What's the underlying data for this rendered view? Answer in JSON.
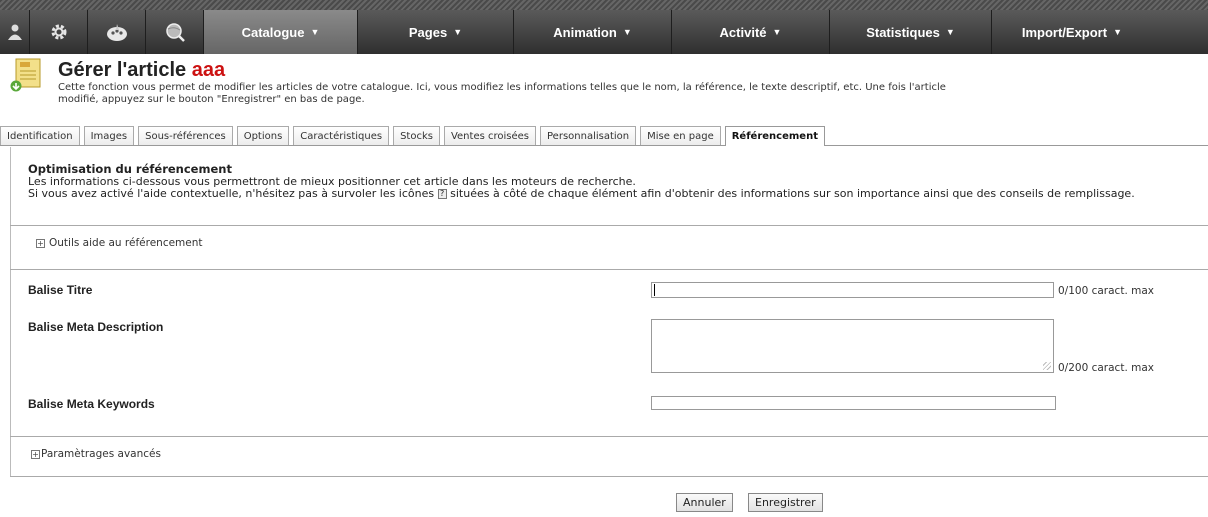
{
  "nav": {
    "icons": [
      "user-icon",
      "gear-icon",
      "palette-icon",
      "globe-icon"
    ],
    "items": [
      {
        "label": "Catalogue",
        "active": true
      },
      {
        "label": "Pages",
        "active": false
      },
      {
        "label": "Animation",
        "active": false
      },
      {
        "label": "Activité",
        "active": false
      },
      {
        "label": "Statistiques",
        "active": false
      },
      {
        "label": "Import/Export",
        "active": false
      }
    ],
    "caret": "▼"
  },
  "header": {
    "title": "Gérer l'article",
    "article_name": "aaa",
    "description": "Cette fonction vous permet de modifier les articles de votre catalogue. Ici, vous modifiez les informations telles que le nom, la référence, le texte descriptif, etc. Une fois l'article modifié, appuyez sur le bouton \"Enregistrer\" en bas de page."
  },
  "tabs": [
    {
      "label": "Identification",
      "active": false
    },
    {
      "label": "Images",
      "active": false
    },
    {
      "label": "Sous-références",
      "active": false
    },
    {
      "label": "Options",
      "active": false
    },
    {
      "label": "Caractéristiques",
      "active": false
    },
    {
      "label": "Stocks",
      "active": false
    },
    {
      "label": "Ventes croisées",
      "active": false
    },
    {
      "label": "Personnalisation",
      "active": false
    },
    {
      "label": "Mise en page",
      "active": false
    },
    {
      "label": "Référencement",
      "active": true
    }
  ],
  "optimisation": {
    "heading": "Optimisation du référencement",
    "line1": "Les informations ci-dessous vous permettront de mieux positionner cet article dans les moteurs de recherche.",
    "line2_before": "Si vous avez activé l'aide contextuelle, n'hésitez pas à survoler les icônes",
    "help_glyph": "?",
    "line2_after": "situées à côté de chaque élément afin d'obtenir des informations sur son importance ainsi que des conseils de remplissage."
  },
  "tools_expander": {
    "symbol": "+",
    "label": "Outils aide au référencement"
  },
  "fields": {
    "title": {
      "label": "Balise Titre",
      "value": "",
      "counter": "0/100 caract. max"
    },
    "description": {
      "label": "Balise Meta Description",
      "value": "",
      "counter": "0/200 caract. max"
    },
    "keywords": {
      "label": "Balise Meta Keywords",
      "value": ""
    }
  },
  "advanced_expander": {
    "symbol": "+",
    "label": "Paramètrages avancés"
  },
  "buttons": {
    "cancel": "Annuler",
    "save": "Enregistrer"
  }
}
